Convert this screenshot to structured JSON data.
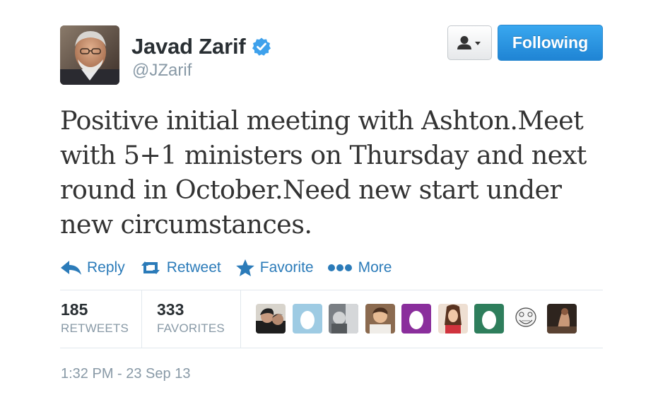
{
  "author": {
    "name": "Javad Zarif",
    "handle": "@JZarif",
    "verified_icon": "verified-badge-icon",
    "avatar_icon": "profile-avatar"
  },
  "buttons": {
    "user_dropdown_icon": "user-icon",
    "follow_label": "Following"
  },
  "tweet": {
    "text": "Positive initial meeting with Ashton.Meet with 5+1 ministers on Thursday and next round in October.Need new start under new circumstances."
  },
  "actions": [
    {
      "label": "Reply",
      "icon": "reply-icon"
    },
    {
      "label": "Retweet",
      "icon": "retweet-icon"
    },
    {
      "label": "Favorite",
      "icon": "star-icon"
    },
    {
      "label": "More",
      "icon": "more-dots-icon"
    }
  ],
  "stats": {
    "retweets_count": "185",
    "retweets_label": "RETWEETS",
    "favorites_count": "333",
    "favorites_label": "FAVORITES"
  },
  "favoriters": [
    "user-avatar-1",
    "egg-avatar-light-blue",
    "user-avatar-3",
    "user-avatar-4",
    "egg-avatar-purple",
    "user-avatar-6",
    "egg-avatar-green",
    "meme-face-avatar",
    "user-avatar-9"
  ],
  "timestamp": "1:32 PM - 23 Sep 13",
  "colors": {
    "link_blue": "#2b7bb9",
    "follow_button": "#2d94e2",
    "muted_text": "#8899a6",
    "verified_blue": "#3ea1ec"
  }
}
